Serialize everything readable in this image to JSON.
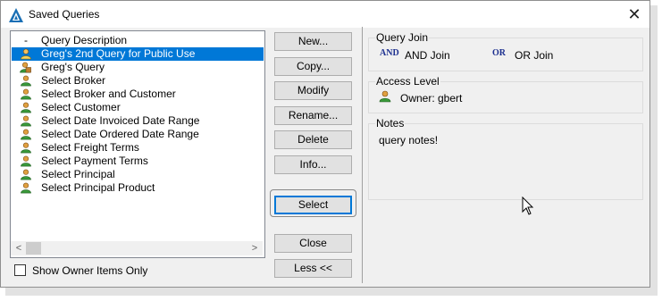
{
  "window": {
    "title": "Saved Queries"
  },
  "query_list": {
    "header": {
      "marker": "-",
      "label": "Query Description"
    },
    "items": [
      {
        "label": "Greg's 2nd Query for Public Use",
        "icon": "user-public-icon",
        "selected": true
      },
      {
        "label": "Greg's Query",
        "icon": "user-lock-icon",
        "selected": false
      },
      {
        "label": "Select Broker",
        "icon": "user-icon",
        "selected": false
      },
      {
        "label": "Select Broker and Customer",
        "icon": "user-icon",
        "selected": false
      },
      {
        "label": "Select Customer",
        "icon": "user-icon",
        "selected": false
      },
      {
        "label": "Select Date Invoiced Date Range",
        "icon": "user-icon",
        "selected": false
      },
      {
        "label": "Select Date Ordered Date Range",
        "icon": "user-icon",
        "selected": false
      },
      {
        "label": "Select Freight Terms",
        "icon": "user-icon",
        "selected": false
      },
      {
        "label": "Select Payment Terms",
        "icon": "user-icon",
        "selected": false
      },
      {
        "label": "Select Principal",
        "icon": "user-icon",
        "selected": false
      },
      {
        "label": "Select Principal Product",
        "icon": "user-icon",
        "selected": false
      }
    ]
  },
  "show_owner_only": {
    "label": "Show Owner Items Only",
    "checked": false
  },
  "buttons": {
    "new": "New...",
    "copy": "Copy...",
    "modify": "Modify",
    "rename": "Rename...",
    "delete": "Delete",
    "info": "Info...",
    "select": "Select",
    "close": "Close",
    "less": "Less <<"
  },
  "query_join": {
    "label": "Query Join",
    "and_icon": "AND",
    "and_label": "AND Join",
    "or_icon": "OR",
    "or_label": "OR Join"
  },
  "access_level": {
    "label": "Access Level",
    "owner": "Owner: gbert"
  },
  "notes": {
    "label": "Notes",
    "text": "query notes!"
  },
  "colors": {
    "selection": "#0078d7",
    "accent": "#0078d7",
    "join_icon": "#1c2f8f"
  }
}
